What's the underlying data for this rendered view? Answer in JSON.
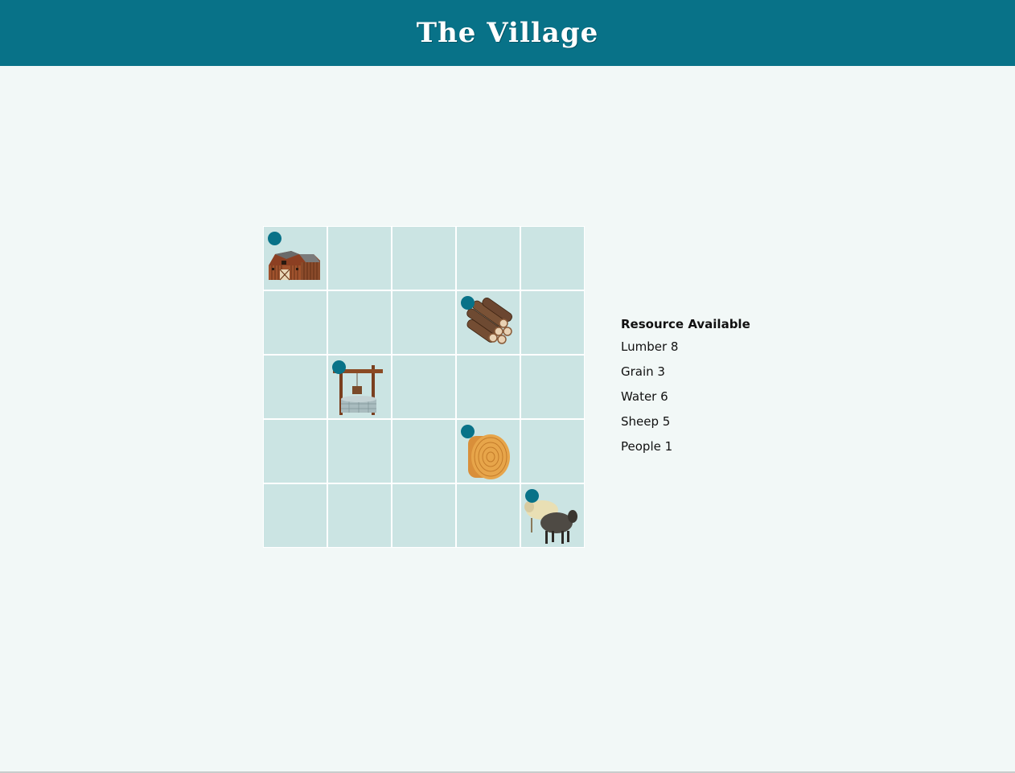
{
  "header": {
    "title": "The Village"
  },
  "grid": {
    "rows": 5,
    "cols": 5,
    "cells": [
      {
        "r": 0,
        "c": 0,
        "item": "barn-icon",
        "marker": true
      },
      {
        "r": 1,
        "c": 3,
        "item": "lumber-icon",
        "marker": true
      },
      {
        "r": 2,
        "c": 1,
        "item": "well-icon",
        "marker": true
      },
      {
        "r": 3,
        "c": 3,
        "item": "hay-bale-icon",
        "marker": true
      },
      {
        "r": 4,
        "c": 4,
        "item": "sheep-icon",
        "marker": true
      }
    ]
  },
  "resources": {
    "heading": "Resource  Available",
    "items": [
      {
        "label": "Lumber 8"
      },
      {
        "label": "Grain 3"
      },
      {
        "label": "Water 6"
      },
      {
        "label": "Sheep 5"
      },
      {
        "label": "People 1"
      }
    ]
  },
  "colors": {
    "header_bg": "#087288",
    "cell_bg": "#cbe4e3",
    "page_bg": "#f2f8f7",
    "marker": "#087288"
  }
}
